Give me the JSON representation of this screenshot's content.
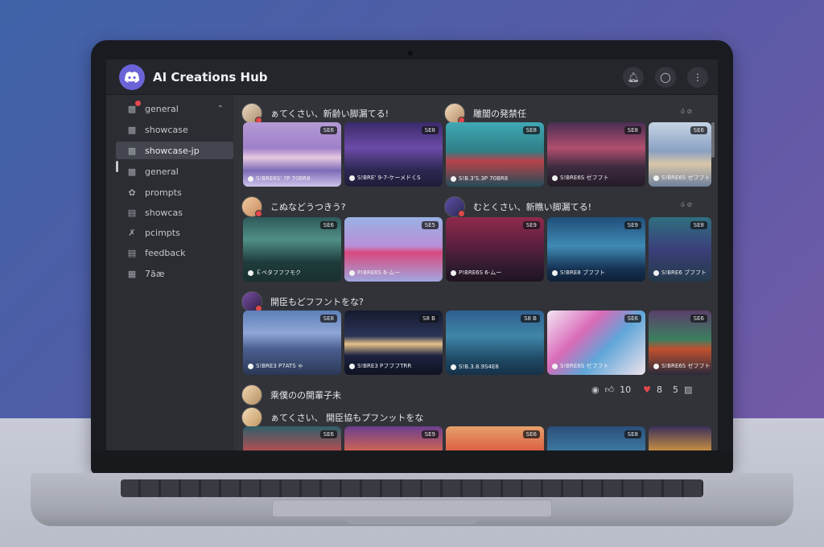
{
  "app": {
    "title": "AI Creations Hub"
  },
  "header": {
    "icons": [
      "bell-icon",
      "user-icon",
      "more-icon"
    ]
  },
  "sidebar": {
    "channels": [
      {
        "label": "general",
        "icon": "bot-icon"
      },
      {
        "label": "showcase",
        "icon": "bot-icon"
      },
      {
        "label": "showcase-jp",
        "icon": "bot-icon"
      },
      {
        "label": "general",
        "icon": "bot-icon"
      },
      {
        "label": "prompts",
        "icon": "palette-icon"
      },
      {
        "label": "showcas",
        "icon": "list-icon"
      },
      {
        "label": "pcimpts",
        "icon": "tools-icon"
      },
      {
        "label": "feedback",
        "icon": "list-icon"
      },
      {
        "label": "7ãæ",
        "icon": "puzzle-icon"
      }
    ]
  },
  "feed": {
    "posts": [
      {
        "title": "ぁてくさい、新齢い脚漏てる!"
      },
      {
        "title": "雕闇の発禁任"
      },
      {
        "title": "こぬなどうつきう?"
      },
      {
        "title": "むとくさい、新瞧い脚漏てる!"
      },
      {
        "title": "開臣もどフフントをな?"
      },
      {
        "title": "乘僕のの開輩子未"
      },
      {
        "title": "ぁてくさい、 開臣協もプフンットをな"
      }
    ],
    "row1": [
      {
        "badge": "SE6",
        "caption": "S!BRE6S' ?P 70BR8"
      },
      {
        "badge": "SE8",
        "caption": "S!BRE' 9-7-ケーメドくS"
      },
      {
        "badge": "SE8",
        "caption": "S!B.3'S.3P 70BR8"
      },
      {
        "badge": "SE8",
        "caption": "S!BRE6S ゼフフト"
      },
      {
        "badge": "SE6",
        "caption": "S!BRE6S ゼフフト"
      }
    ],
    "row2": [
      {
        "badge": "SE6",
        "caption": "Ｅベタフフフモク"
      },
      {
        "badge": "SE5",
        "caption": "P!BRE6S 6-ムー"
      },
      {
        "badge": "SE9",
        "caption": "P!BRE6S 6-ムー"
      },
      {
        "badge": "SE9",
        "caption": "S!BRE8 ブフフト"
      },
      {
        "badge": "SE8",
        "caption": "S!BRE6 ブフフト"
      }
    ],
    "row3": [
      {
        "badge": "SE8",
        "caption": "S!BRE3 P7ATS ゃ"
      },
      {
        "badge": "S8 B",
        "caption": "S!BRE3 PフフフTRR"
      },
      {
        "badge": "S8 B",
        "caption": "S!B.3.8.9S4E8"
      },
      {
        "badge": "SE6",
        "caption": "S!BRE6S ゼフフト"
      },
      {
        "badge": "SE6",
        "caption": "S!BRE6S ゼフフト"
      }
    ],
    "row4": [
      {
        "badge": "SE6"
      },
      {
        "badge": "SE9"
      },
      {
        "badge": "SE6"
      },
      {
        "badge": "SE8"
      }
    ],
    "reactions": {
      "likes": "10",
      "hearts": "8",
      "count": "5"
    },
    "small_reacts": [
      "ó ⊘",
      "ó ⊘",
      "ó ⊘",
      "ó ⊘"
    ]
  }
}
